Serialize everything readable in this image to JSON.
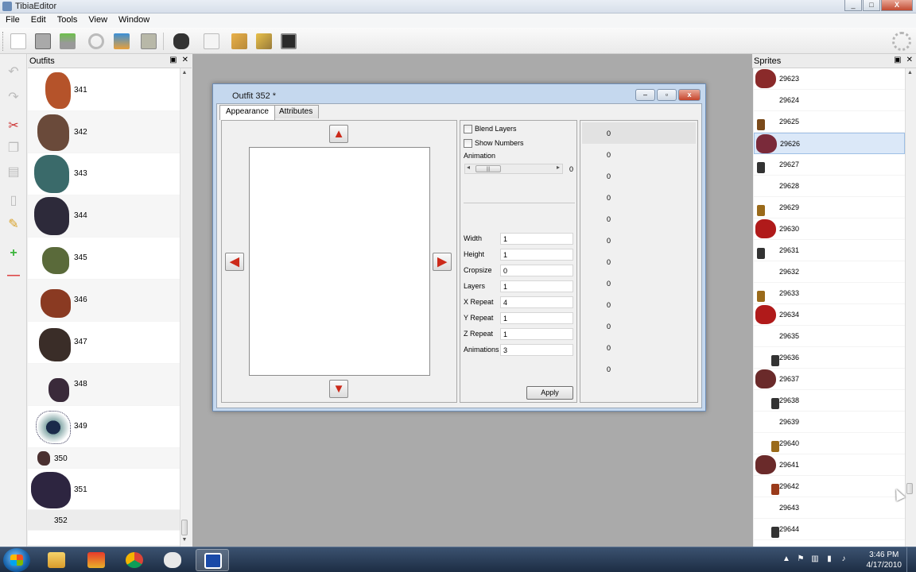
{
  "window": {
    "title": "TibiaEditor",
    "controls": [
      "_",
      "□",
      "X"
    ]
  },
  "menu": [
    "File",
    "Edit",
    "Tools",
    "View",
    "Window"
  ],
  "toolbar": {
    "buttons": [
      "new-icon",
      "open-icon",
      "save-icon",
      "undo-icon",
      "import-icon",
      "spritesheet-icon",
      "find-icon",
      "page-icon",
      "tools-icon",
      "tools2-icon",
      "monitor-icon"
    ],
    "settings_icon": "gear-icon"
  },
  "side_tools": [
    "undo-icon",
    "redo-icon",
    "cut-icon",
    "copy-icon",
    "paste-icon",
    "document-icon",
    "broom-icon",
    "add-icon",
    "remove-icon"
  ],
  "outfits_panel": {
    "title": "Outfits",
    "items": [
      {
        "label": "341",
        "color": "#b5532a"
      },
      {
        "label": "342",
        "color": "#6a4a3a"
      },
      {
        "label": "343",
        "color": "#3a6a6a"
      },
      {
        "label": "344",
        "color": "#2d2a3a"
      },
      {
        "label": "345",
        "color": "#5a6a3a"
      },
      {
        "label": "346",
        "color": "#8a3a22"
      },
      {
        "label": "347",
        "color": "#3a2d28"
      },
      {
        "label": "348",
        "color": "#3a2a3a"
      },
      {
        "label": "349",
        "color": "#2a3a5a"
      },
      {
        "label": "350",
        "color": "#4a3030"
      },
      {
        "label": "351",
        "color": "#2d2540"
      },
      {
        "label": "352",
        "color": "#ffffff"
      }
    ]
  },
  "dialog": {
    "title": "Outfit 352 *",
    "tabs": [
      "Appearance",
      "Attributes"
    ],
    "active_tab": "Appearance",
    "blend_layers": "Blend Layers",
    "show_numbers": "Show Numbers",
    "animation_label": "Animation",
    "animation_value": "0",
    "fields": [
      {
        "label": "Width",
        "value": "1"
      },
      {
        "label": "Height",
        "value": "1"
      },
      {
        "label": "Cropsize",
        "value": "0"
      },
      {
        "label": "Layers",
        "value": "1"
      },
      {
        "label": "X Repeat",
        "value": "4"
      },
      {
        "label": "Y Repeat",
        "value": "1"
      },
      {
        "label": "Z Repeat",
        "value": "1"
      },
      {
        "label": "Animations",
        "value": "3"
      }
    ],
    "apply_label": "Apply",
    "frames": [
      "0",
      "0",
      "0",
      "0",
      "0",
      "0",
      "0",
      "0",
      "0",
      "0",
      "0",
      "0"
    ]
  },
  "sprites_panel": {
    "title": "Sprites",
    "items": [
      {
        "label": "29623",
        "color": "#8a2a2a"
      },
      {
        "label": "29624",
        "color": ""
      },
      {
        "label": "29625",
        "color": "#7a4a1a"
      },
      {
        "label": "29626",
        "color": "#7a2a3a"
      },
      {
        "label": "29627",
        "color": "#333333"
      },
      {
        "label": "29628",
        "color": ""
      },
      {
        "label": "29629",
        "color": "#9a6a1a"
      },
      {
        "label": "29630",
        "color": "#b01a1a"
      },
      {
        "label": "29631",
        "color": "#333333"
      },
      {
        "label": "29632",
        "color": ""
      },
      {
        "label": "29633",
        "color": "#9a6a1a"
      },
      {
        "label": "29634",
        "color": "#b01a1a"
      },
      {
        "label": "29635",
        "color": ""
      },
      {
        "label": "29636",
        "color": "#333333"
      },
      {
        "label": "29637",
        "color": "#6a2a2a"
      },
      {
        "label": "29638",
        "color": "#333333"
      },
      {
        "label": "29639",
        "color": ""
      },
      {
        "label": "29640",
        "color": "#9a6a1a"
      },
      {
        "label": "29641",
        "color": "#6a2a2a"
      },
      {
        "label": "29642",
        "color": "#9a3a1a"
      },
      {
        "label": "29643",
        "color": ""
      },
      {
        "label": "29644",
        "color": "#333333"
      }
    ],
    "selected": "29626"
  },
  "taskbar": {
    "apps": [
      "explorer-icon",
      "game-icon",
      "chrome-icon",
      "skull-icon",
      "tibia-editor-icon"
    ],
    "time": "3:46 PM",
    "date": "4/17/2010"
  }
}
